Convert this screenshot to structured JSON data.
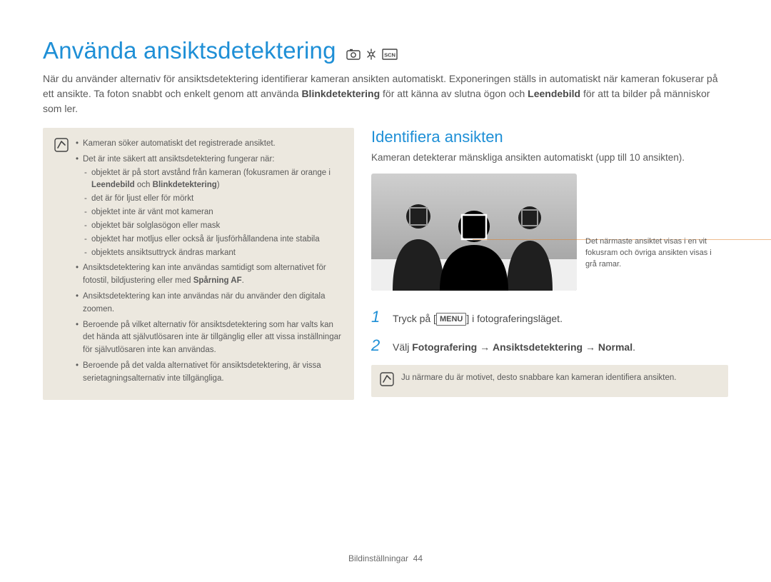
{
  "title": "Använda ansiktsdetektering",
  "lead_parts": {
    "a": "När du använder alternativ för ansiktsdetektering identifierar kameran ansikten automatiskt. Exponeringen ställs in automatiskt när kameran fokuserar på ett ansikte. Ta foton snabbt och enkelt genom att använda ",
    "b": "Blinkdetektering",
    "c": " för att känna av slutna ögon och ",
    "d": "Leendebild",
    "e": " för att ta bilder på människor som ler."
  },
  "note": {
    "li1": "Kameran söker automatiskt det registrerade ansiktet.",
    "li2_intro": "Det är inte säkert att ansiktsdetektering fungerar när:",
    "sub1_a": "objektet är på stort avstånd från kameran (fokusramen är orange i ",
    "sub1_b": "Leendebild",
    "sub1_c": " och ",
    "sub1_d": "Blinkdetektering",
    "sub1_e": ")",
    "sub2": "det är för ljust eller för mörkt",
    "sub3": "objektet inte är vänt mot kameran",
    "sub4": "objektet bär solglasögon eller mask",
    "sub5": "objektet har motljus eller också är ljusförhållandena inte stabila",
    "sub6": "objektets ansiktsuttryck ändras markant",
    "li3_a": "Ansiktsdetektering kan inte användas samtidigt som alternativet för fotostil, bildjustering eller med ",
    "li3_b": "Spårning AF",
    "li3_c": ".",
    "li4": "Ansiktsdetektering kan inte användas när du använder den digitala zoomen.",
    "li5": "Beroende på vilket alternativ för ansiktsdetektering som har valts kan det hända att självutlösaren inte är tillgänglig eller att vissa inställningar för självutlösaren inte kan användas.",
    "li6": "Beroende på det valda alternativet för ansiktsdetektering, är vissa serietagningsalternativ inte tillgängliga."
  },
  "section": {
    "title": "Identifiera ansikten",
    "desc": "Kameran detekterar mänskliga ansikten automatiskt (upp till 10 ansikten)."
  },
  "callout": "Det närmaste ansiktet visas i en vit fokusram och övriga ansikten visas i grå ramar.",
  "steps": {
    "s1_a": "Tryck på [",
    "s1_menu": "MENU",
    "s1_b": "] i fotograferingsläget.",
    "s2_a": "Välj ",
    "s2_b": "Fotografering",
    "s2_c": " → ",
    "s2_d": "Ansiktsdetektering",
    "s2_e": " → ",
    "s2_f": "Normal",
    "s2_g": "."
  },
  "tip": "Ju närmare du är motivet, desto snabbare kan kameran identifiera ansikten.",
  "footer_a": "Bildinställningar",
  "footer_b": "44"
}
